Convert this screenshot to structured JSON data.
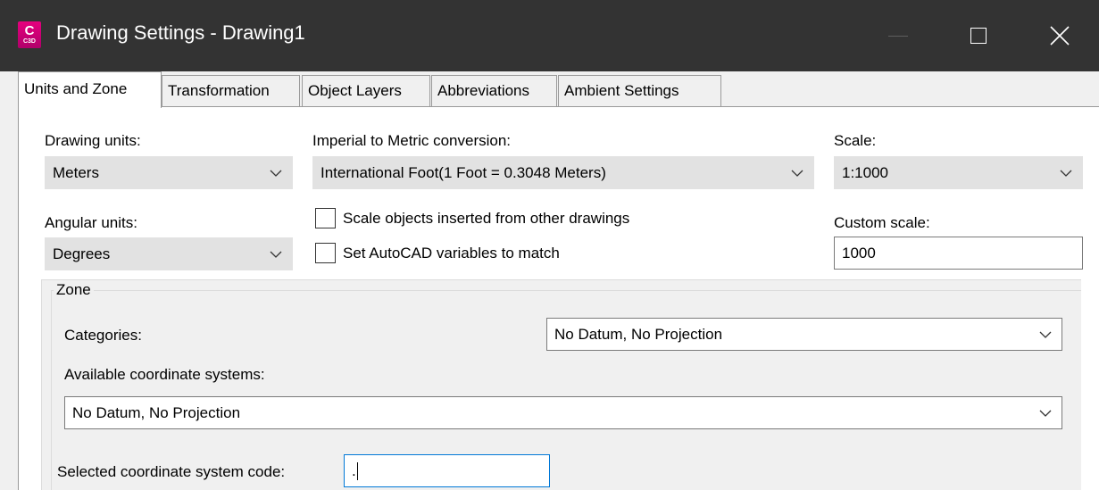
{
  "window": {
    "app_icon_letter": "C",
    "app_icon_sub": "C3D",
    "title": "Drawing Settings - Drawing1"
  },
  "tabs": [
    {
      "label": "Units and Zone",
      "active": true
    },
    {
      "label": "Transformation",
      "active": false
    },
    {
      "label": "Object Layers",
      "active": false
    },
    {
      "label": "Abbreviations",
      "active": false
    },
    {
      "label": "Ambient Settings",
      "active": false
    }
  ],
  "units": {
    "drawing_units_label": "Drawing units:",
    "drawing_units_value": "Meters",
    "conversion_label": "Imperial to Metric conversion:",
    "conversion_value": "International Foot(1 Foot = 0.3048 Meters)",
    "scale_label": "Scale:",
    "scale_value": "1:1000",
    "angular_units_label": "Angular units:",
    "angular_units_value": "Degrees",
    "scale_objects_label": "Scale objects inserted from other drawings",
    "scale_objects_checked": false,
    "set_variables_label": "Set AutoCAD variables to match",
    "set_variables_checked": false,
    "custom_scale_label": "Custom scale:",
    "custom_scale_value": "1000"
  },
  "zone": {
    "title": "Zone",
    "categories_label": "Categories:",
    "categories_value": "No Datum, No Projection",
    "available_label": "Available coordinate systems:",
    "available_value": "No Datum, No Projection",
    "selected_code_label": "Selected coordinate system code:",
    "selected_code_value": "."
  },
  "colors": {
    "titlebar": "#333333",
    "icon_magenta": "#e6007e",
    "focus_blue": "#0078d7"
  }
}
